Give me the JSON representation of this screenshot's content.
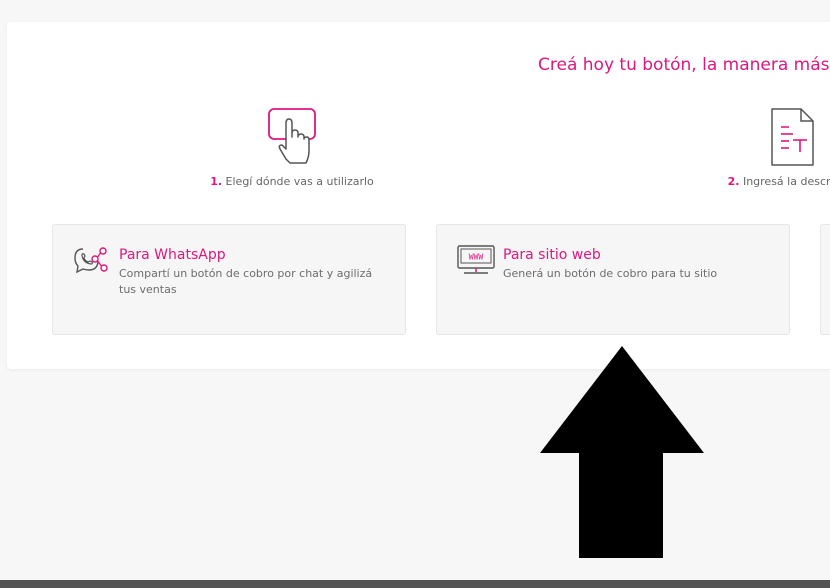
{
  "headline": "Creá hoy tu botón, la manera más sim",
  "steps": [
    {
      "number": "1.",
      "label": "Elegí dónde vas a utilizarlo",
      "icon": "touch-button-icon"
    },
    {
      "number": "2.",
      "label": "Ingresá la descripció",
      "icon": "document-text-icon"
    }
  ],
  "cards": [
    {
      "title": "Para WhatsApp",
      "description": "Compartí un botón de cobro por chat y agilizá tus ventas",
      "icon": "whatsapp-share-icon"
    },
    {
      "title": "Para sitio web",
      "description": "Generá un botón de cobro para tu sitio",
      "icon": "www-monitor-icon"
    }
  ],
  "colors": {
    "accent": "#e0167f",
    "text": "#666666",
    "card_bg": "#f6f6f6",
    "page_bg": "#f7f7f7"
  }
}
